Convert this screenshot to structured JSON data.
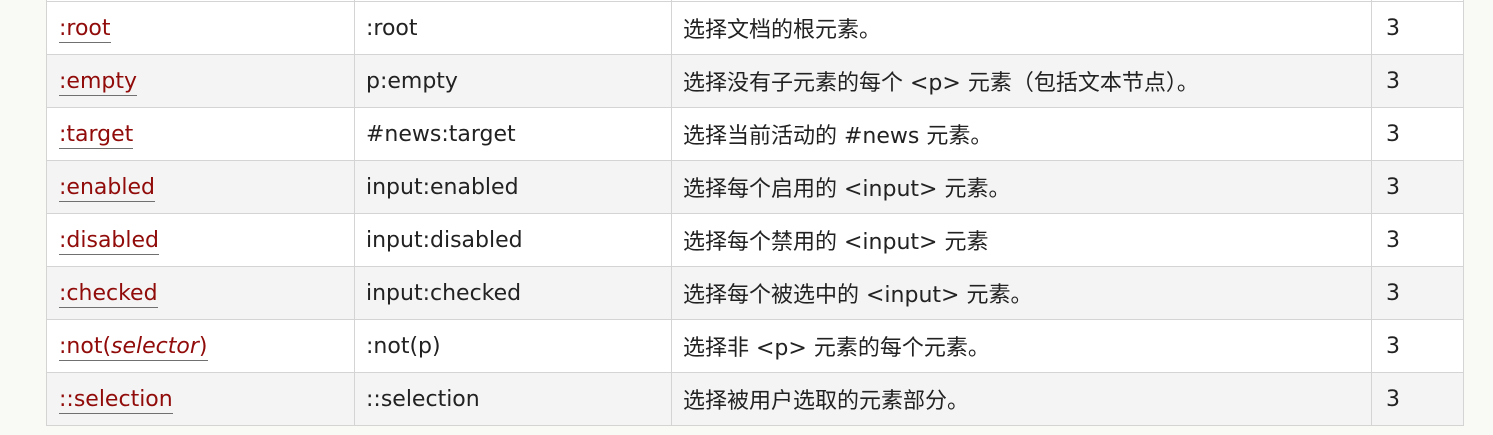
{
  "rows": [
    {
      "selector": ":root",
      "selector_italic": "",
      "selector_suffix": "",
      "example": ":root",
      "description": "选择文档的根元素。",
      "version": "3"
    },
    {
      "selector": ":empty",
      "selector_italic": "",
      "selector_suffix": "",
      "example": "p:empty",
      "description": "选择没有子元素的每个 <p> 元素（包括文本节点）。",
      "version": "3"
    },
    {
      "selector": ":target",
      "selector_italic": "",
      "selector_suffix": "",
      "example": "#news:target",
      "description": "选择当前活动的 #news 元素。",
      "version": "3"
    },
    {
      "selector": ":enabled",
      "selector_italic": "",
      "selector_suffix": "",
      "example": "input:enabled",
      "description": "选择每个启用的 <input> 元素。",
      "version": "3"
    },
    {
      "selector": ":disabled",
      "selector_italic": "",
      "selector_suffix": "",
      "example": "input:disabled",
      "description": "选择每个禁用的 <input> 元素",
      "version": "3"
    },
    {
      "selector": ":checked",
      "selector_italic": "",
      "selector_suffix": "",
      "example": "input:checked",
      "description": "选择每个被选中的 <input> 元素。",
      "version": "3"
    },
    {
      "selector": ":not(",
      "selector_italic": "selector",
      "selector_suffix": ")",
      "example": ":not(p)",
      "description": "选择非 <p> 元素的每个元素。",
      "version": "3"
    },
    {
      "selector": "::selection",
      "selector_italic": "",
      "selector_suffix": "",
      "example": "::selection",
      "description": "选择被用户选取的元素部分。",
      "version": "3"
    }
  ]
}
